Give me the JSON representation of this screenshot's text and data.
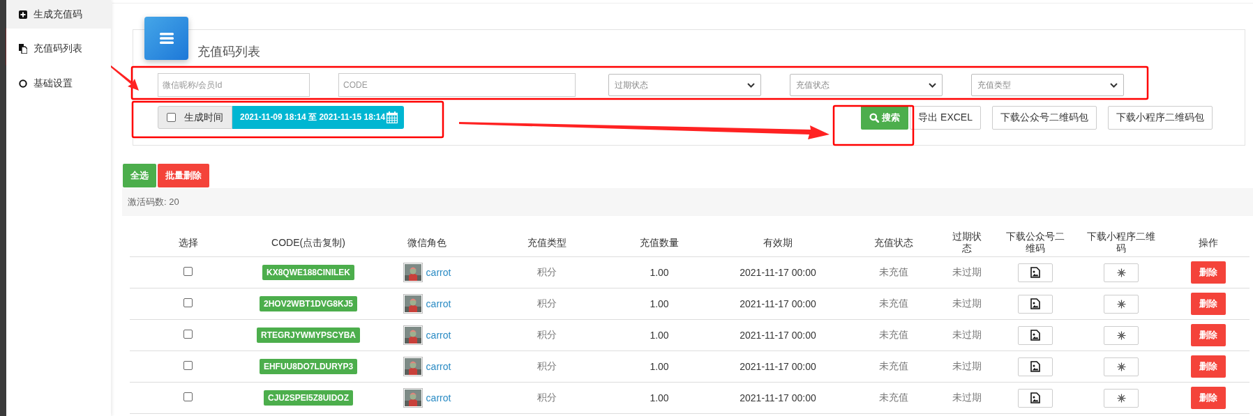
{
  "sidebar": {
    "items": [
      {
        "label": "生成充值码",
        "selected": true
      },
      {
        "label": "充值码列表",
        "selected": false
      },
      {
        "label": "基础设置",
        "selected": false
      }
    ]
  },
  "panel": {
    "title": "充值码列表",
    "filters": [
      {
        "kind": "input",
        "placeholder": "微信昵称/会员Id"
      },
      {
        "kind": "input",
        "placeholder": "CODE"
      },
      {
        "kind": "select",
        "placeholder": "过期状态"
      },
      {
        "kind": "select",
        "placeholder": "充值状态"
      },
      {
        "kind": "select",
        "placeholder": "充值类型"
      }
    ],
    "date_filter": {
      "label": "生成时间",
      "checked": false,
      "range": "2021-11-09 18:14 至 2021-11-15 18:14"
    },
    "actions": [
      {
        "label": "搜索",
        "kind": "primary"
      },
      {
        "label": "导出 EXCEL",
        "kind": "default"
      },
      {
        "label": "下载公众号二维码包",
        "kind": "default"
      },
      {
        "label": "下载小程序二维码包",
        "kind": "default"
      }
    ]
  },
  "bulk_buttons": [
    {
      "label": "全选",
      "kind": "success"
    },
    {
      "label": "批量删除",
      "kind": "danger"
    }
  ],
  "count_text": "激活码数: 20",
  "table": {
    "columns": [
      "选择",
      "CODE(点击复制)",
      "微信角色",
      "充值类型",
      "充值数量",
      "有效期",
      "充值状态",
      "过期状态",
      "下载公众号二维码",
      "下载小程序二维码",
      "操作"
    ],
    "rows": [
      {
        "checked": false,
        "code": "KX8QWE188CINILEK",
        "user": "carrot",
        "type": "积分",
        "amount": "1.00",
        "expiry": "2021-11-17 00:00",
        "charge_status": "未充值",
        "expire_status": "未过期",
        "action": "删除"
      },
      {
        "checked": false,
        "code": "2HOV2WBT1DVG8KJ5",
        "user": "carrot",
        "type": "积分",
        "amount": "1.00",
        "expiry": "2021-11-17 00:00",
        "charge_status": "未充值",
        "expire_status": "未过期",
        "action": "删除"
      },
      {
        "checked": false,
        "code": "RTEGRJYWMYPSCYBA",
        "user": "carrot",
        "type": "积分",
        "amount": "1.00",
        "expiry": "2021-11-17 00:00",
        "charge_status": "未充值",
        "expire_status": "未过期",
        "action": "删除"
      },
      {
        "checked": false,
        "code": "EHFUU8DO7LDURYP3",
        "user": "carrot",
        "type": "积分",
        "amount": "1.00",
        "expiry": "2021-11-17 00:00",
        "charge_status": "未充值",
        "expire_status": "未过期",
        "action": "删除"
      },
      {
        "checked": false,
        "code": "CJU2SPEI5Z8UIDOZ",
        "user": "carrot",
        "type": "积分",
        "amount": "1.00",
        "expiry": "2021-11-17 00:00",
        "charge_status": "未充值",
        "expire_status": "未过期",
        "action": "删除"
      }
    ]
  }
}
